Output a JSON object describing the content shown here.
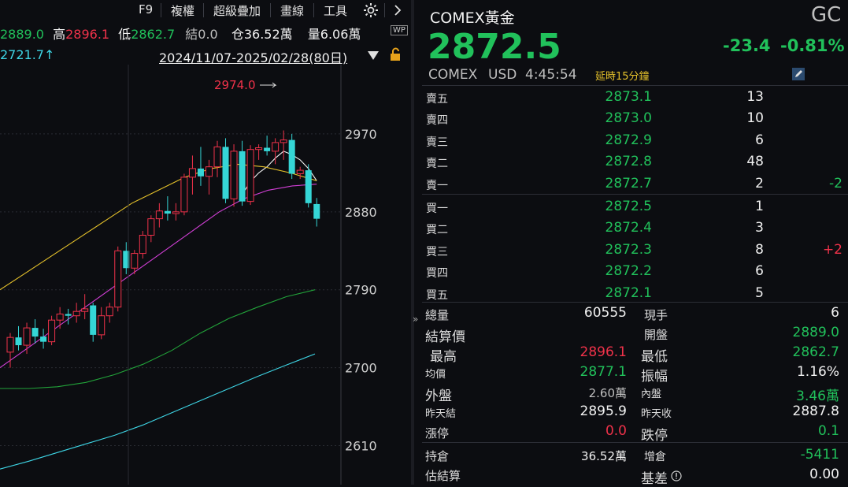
{
  "toolbar": {
    "f9": "F9",
    "replicate": "複權",
    "overlay": "超級疊加",
    "draw": "畫線",
    "tools": "工具",
    "settings_icon": "gear-icon",
    "next_icon": "chevron-right-icon"
  },
  "stats_bar": {
    "open_value": "2889.0",
    "high_label": "高",
    "high_value": "2896.1",
    "low_label": "低",
    "low_value": "2862.7",
    "settle_label": "結",
    "settle_value": "0.0",
    "oi_label": "仓",
    "oi_value": "36.52萬",
    "vol_label": "量",
    "vol_value": "6.06萬",
    "wp_badge": "WP"
  },
  "chart_header": {
    "left_value": "2721.7↑",
    "date_range": "2024/11/07-2025/02/28(80日)",
    "lock_icon": "lock-icon",
    "dropdown_icon": "triangle-down-icon"
  },
  "chart_data": {
    "type": "candlestick",
    "y_ticks": [
      "2970",
      "2880",
      "2790",
      "2700",
      "2610"
    ],
    "y_tick_values": [
      2970,
      2880,
      2790,
      2700,
      2610
    ],
    "ylim": [
      2565,
      3050
    ],
    "max_label": "2974.0",
    "colors": {
      "up": "#f0324a",
      "down": "#35d6d6",
      "ma5": "#f2f2f2",
      "ma10": "#e6c22b",
      "ma20": "#d23fd6",
      "ma60": "#22a33a",
      "ma120": "#3ed6e6"
    },
    "candles": [
      {
        "o": 2718,
        "h": 2740,
        "l": 2700,
        "c": 2735
      },
      {
        "o": 2735,
        "h": 2748,
        "l": 2720,
        "c": 2726
      },
      {
        "o": 2726,
        "h": 2752,
        "l": 2716,
        "c": 2746
      },
      {
        "o": 2746,
        "h": 2756,
        "l": 2728,
        "c": 2736
      },
      {
        "o": 2736,
        "h": 2745,
        "l": 2722,
        "c": 2730
      },
      {
        "o": 2730,
        "h": 2760,
        "l": 2726,
        "c": 2755
      },
      {
        "o": 2755,
        "h": 2770,
        "l": 2745,
        "c": 2762
      },
      {
        "o": 2762,
        "h": 2768,
        "l": 2750,
        "c": 2760
      },
      {
        "o": 2760,
        "h": 2775,
        "l": 2752,
        "c": 2765
      },
      {
        "o": 2765,
        "h": 2785,
        "l": 2756,
        "c": 2768
      },
      {
        "o": 2772,
        "h": 2775,
        "l": 2730,
        "c": 2738
      },
      {
        "o": 2738,
        "h": 2770,
        "l": 2733,
        "c": 2760
      },
      {
        "o": 2760,
        "h": 2775,
        "l": 2752,
        "c": 2770
      },
      {
        "o": 2770,
        "h": 2840,
        "l": 2765,
        "c": 2835
      },
      {
        "o": 2835,
        "h": 2845,
        "l": 2808,
        "c": 2815
      },
      {
        "o": 2815,
        "h": 2836,
        "l": 2808,
        "c": 2832
      },
      {
        "o": 2832,
        "h": 2858,
        "l": 2826,
        "c": 2853
      },
      {
        "o": 2853,
        "h": 2876,
        "l": 2845,
        "c": 2872
      },
      {
        "o": 2872,
        "h": 2890,
        "l": 2862,
        "c": 2881
      },
      {
        "o": 2881,
        "h": 2898,
        "l": 2870,
        "c": 2878
      },
      {
        "o": 2878,
        "h": 2890,
        "l": 2870,
        "c": 2880
      },
      {
        "o": 2880,
        "h": 2924,
        "l": 2876,
        "c": 2920
      },
      {
        "o": 2920,
        "h": 2945,
        "l": 2900,
        "c": 2930
      },
      {
        "o": 2930,
        "h": 2955,
        "l": 2910,
        "c": 2921
      },
      {
        "o": 2921,
        "h": 2940,
        "l": 2900,
        "c": 2932
      },
      {
        "o": 2932,
        "h": 2962,
        "l": 2920,
        "c": 2955
      },
      {
        "o": 2955,
        "h": 2965,
        "l": 2890,
        "c": 2895
      },
      {
        "o": 2895,
        "h": 2958,
        "l": 2886,
        "c": 2950
      },
      {
        "o": 2950,
        "h": 2962,
        "l": 2887,
        "c": 2892
      },
      {
        "o": 2892,
        "h": 2957,
        "l": 2888,
        "c": 2952
      },
      {
        "o": 2952,
        "h": 2958,
        "l": 2940,
        "c": 2954
      },
      {
        "o": 2954,
        "h": 2968,
        "l": 2945,
        "c": 2950
      },
      {
        "o": 2950,
        "h": 2965,
        "l": 2935,
        "c": 2960
      },
      {
        "o": 2960,
        "h": 2974,
        "l": 2940,
        "c": 2963
      },
      {
        "o": 2963,
        "h": 2970,
        "l": 2918,
        "c": 2924
      },
      {
        "o": 2924,
        "h": 2932,
        "l": 2918,
        "c": 2928
      },
      {
        "o": 2928,
        "h": 2935,
        "l": 2885,
        "c": 2890
      },
      {
        "o": 2889,
        "h": 2896,
        "l": 2863,
        "c": 2872
      }
    ],
    "ma_lines": {
      "ma5": [
        2900,
        2915,
        2925,
        2932,
        2942,
        2950,
        2946,
        2940,
        2930,
        2916
      ],
      "ma10": [
        2790,
        2810,
        2830,
        2850,
        2870,
        2890,
        2905,
        2920,
        2930,
        2935,
        2932,
        2925,
        2916
      ],
      "ma20": [
        2700,
        2720,
        2740,
        2760,
        2780,
        2800,
        2820,
        2840,
        2860,
        2880,
        2895,
        2905,
        2910,
        2912
      ],
      "ma60": [
        2676,
        2676,
        2678,
        2683,
        2692,
        2704,
        2720,
        2740,
        2757,
        2770,
        2782,
        2790
      ],
      "ma120": [
        2583,
        2592,
        2602,
        2612,
        2622,
        2634,
        2648,
        2662,
        2676,
        2690,
        2703,
        2716
      ]
    }
  },
  "quote": {
    "name": "COMEX黃金",
    "code": "GC",
    "price": "2872.5",
    "change": "-23.4",
    "change_pct": "-0.81%",
    "exchange": "COMEX",
    "currency": "USD",
    "time": "4:45:54",
    "delay_note": "延時15分鐘",
    "edit_icon": "pencil-icon"
  },
  "order_book": {
    "asks": [
      {
        "label": "賣五",
        "price": "2873.1",
        "vol": "13",
        "chg": ""
      },
      {
        "label": "賣四",
        "price": "2873.0",
        "vol": "10",
        "chg": ""
      },
      {
        "label": "賣三",
        "price": "2872.9",
        "vol": "6",
        "chg": ""
      },
      {
        "label": "賣二",
        "price": "2872.8",
        "vol": "48",
        "chg": ""
      },
      {
        "label": "賣一",
        "price": "2872.7",
        "vol": "2",
        "chg": "-2"
      }
    ],
    "bids": [
      {
        "label": "買一",
        "price": "2872.5",
        "vol": "1",
        "chg": ""
      },
      {
        "label": "買二",
        "price": "2872.4",
        "vol": "3",
        "chg": ""
      },
      {
        "label": "買三",
        "price": "2872.3",
        "vol": "8",
        "chg": "+2"
      },
      {
        "label": "買四",
        "price": "2872.2",
        "vol": "6",
        "chg": ""
      },
      {
        "label": "買五",
        "price": "2872.1",
        "vol": "5",
        "chg": ""
      }
    ]
  },
  "stats": {
    "total_vol_label": "總量",
    "total_vol": "60555",
    "current_label": "現手",
    "current": "6",
    "settle_label": "結算價",
    "settle": "",
    "open_label": "開盤",
    "open": "2889.0",
    "high_label": "最高",
    "high": "2896.1",
    "low_label": "最低",
    "low": "2862.7",
    "avg_label": "均價",
    "avg": "2877.1",
    "amp_label": "振幅",
    "amp": "1.16%",
    "outer_label": "外盤",
    "outer": "2.60萬",
    "inner_label": "內盤",
    "inner": "3.46萬",
    "prev_settle_label": "昨天結",
    "prev_settle": "2895.9",
    "prev_close_label": "昨天收",
    "prev_close": "2887.8",
    "limit_up_label": "漲停",
    "limit_up": "0.0",
    "limit_down_label": "跌停",
    "limit_down": "0.1",
    "oi_label": "持倉",
    "oi": "36.52萬",
    "oi_chg_label": "增倉",
    "oi_chg": "-5411",
    "est_settle_label": "估結算",
    "est_settle": "",
    "basis_label": "基差",
    "basis": "0.00",
    "info_icon": "info-icon"
  },
  "collapse_icon": "double-chevron-right-icon"
}
